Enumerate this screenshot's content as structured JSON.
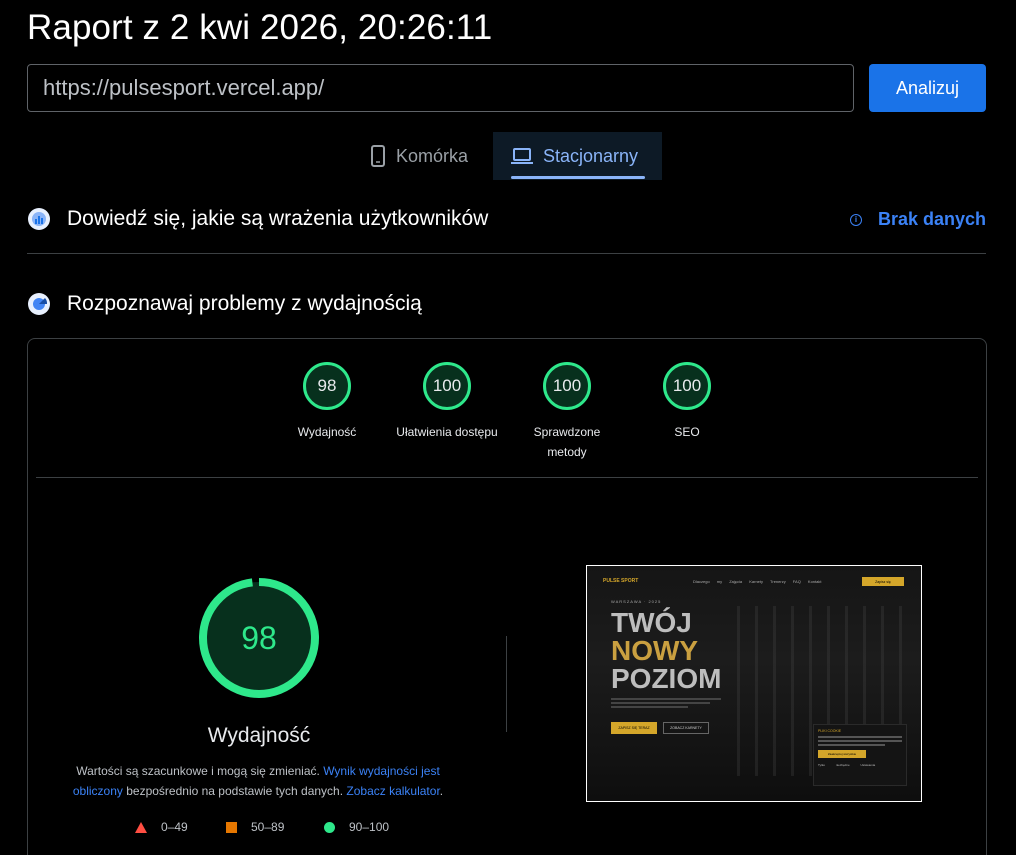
{
  "report": {
    "title": "Raport z 2 kwi 2026, 20:26:11"
  },
  "search": {
    "url": "https://pulsesport.vercel.app/",
    "analyze_label": "Analizuj"
  },
  "tabs": [
    {
      "label": "Komórka",
      "icon": "phone-icon",
      "active": false
    },
    {
      "label": "Stacjonarny",
      "icon": "laptop-icon",
      "active": true
    }
  ],
  "sections": {
    "experience": {
      "title": "Dowiedź się, jakie są wrażenia użytkowników",
      "status": "Brak danych"
    },
    "diagnose": {
      "title": "Rozpoznawaj problemy z wydajnością"
    }
  },
  "categories": [
    {
      "score": "98",
      "label": "Wydajność"
    },
    {
      "score": "100",
      "label": "Ułatwienia dostępu"
    },
    {
      "score": "100",
      "label": "Sprawdzone metody"
    },
    {
      "score": "100",
      "label": "SEO"
    }
  ],
  "performance": {
    "score": "98",
    "score_fraction": 0.98,
    "label": "Wydajność",
    "desc_prefix": "Wartości są szacunkowe i mogą się zmieniać.",
    "desc_link1": "Wynik wydajności jest obliczony",
    "desc_middle": "bezpośrednio na podstawie tych danych.",
    "desc_link2": "Zobacz kalkulator",
    "desc_suffix": "."
  },
  "legend": [
    {
      "range": "0–49",
      "shape": "triangle",
      "color": "#ff4e42"
    },
    {
      "range": "50–89",
      "shape": "square",
      "color": "#e67700"
    },
    {
      "range": "90–100",
      "shape": "circle",
      "color": "#2ee88b"
    }
  ],
  "screenshot": {
    "logo": "PULSE SPORT",
    "nav": "Dlaczego my Zajęcia Karnety Trenerzy FAQ Kontakt",
    "nav_button": "Zapisz się",
    "kicker": "WARSZAWA · 2025",
    "headline": [
      "TWÓJ",
      "NOWY",
      "POZIOM"
    ],
    "cta_primary": "ZAPISZ SIĘ TERAZ",
    "cta_secondary": "ZOBACZ KARNETY",
    "cookie_title": "PLIKI COOKIE",
    "cookie_accept": "Zaakceptuj wszystkie",
    "cookie_footer": "Tylko niezbędne Ustawienia"
  },
  "colors": {
    "pass": "#2ee88b",
    "link": "#3b82f6",
    "accent": "#1a73e8"
  }
}
